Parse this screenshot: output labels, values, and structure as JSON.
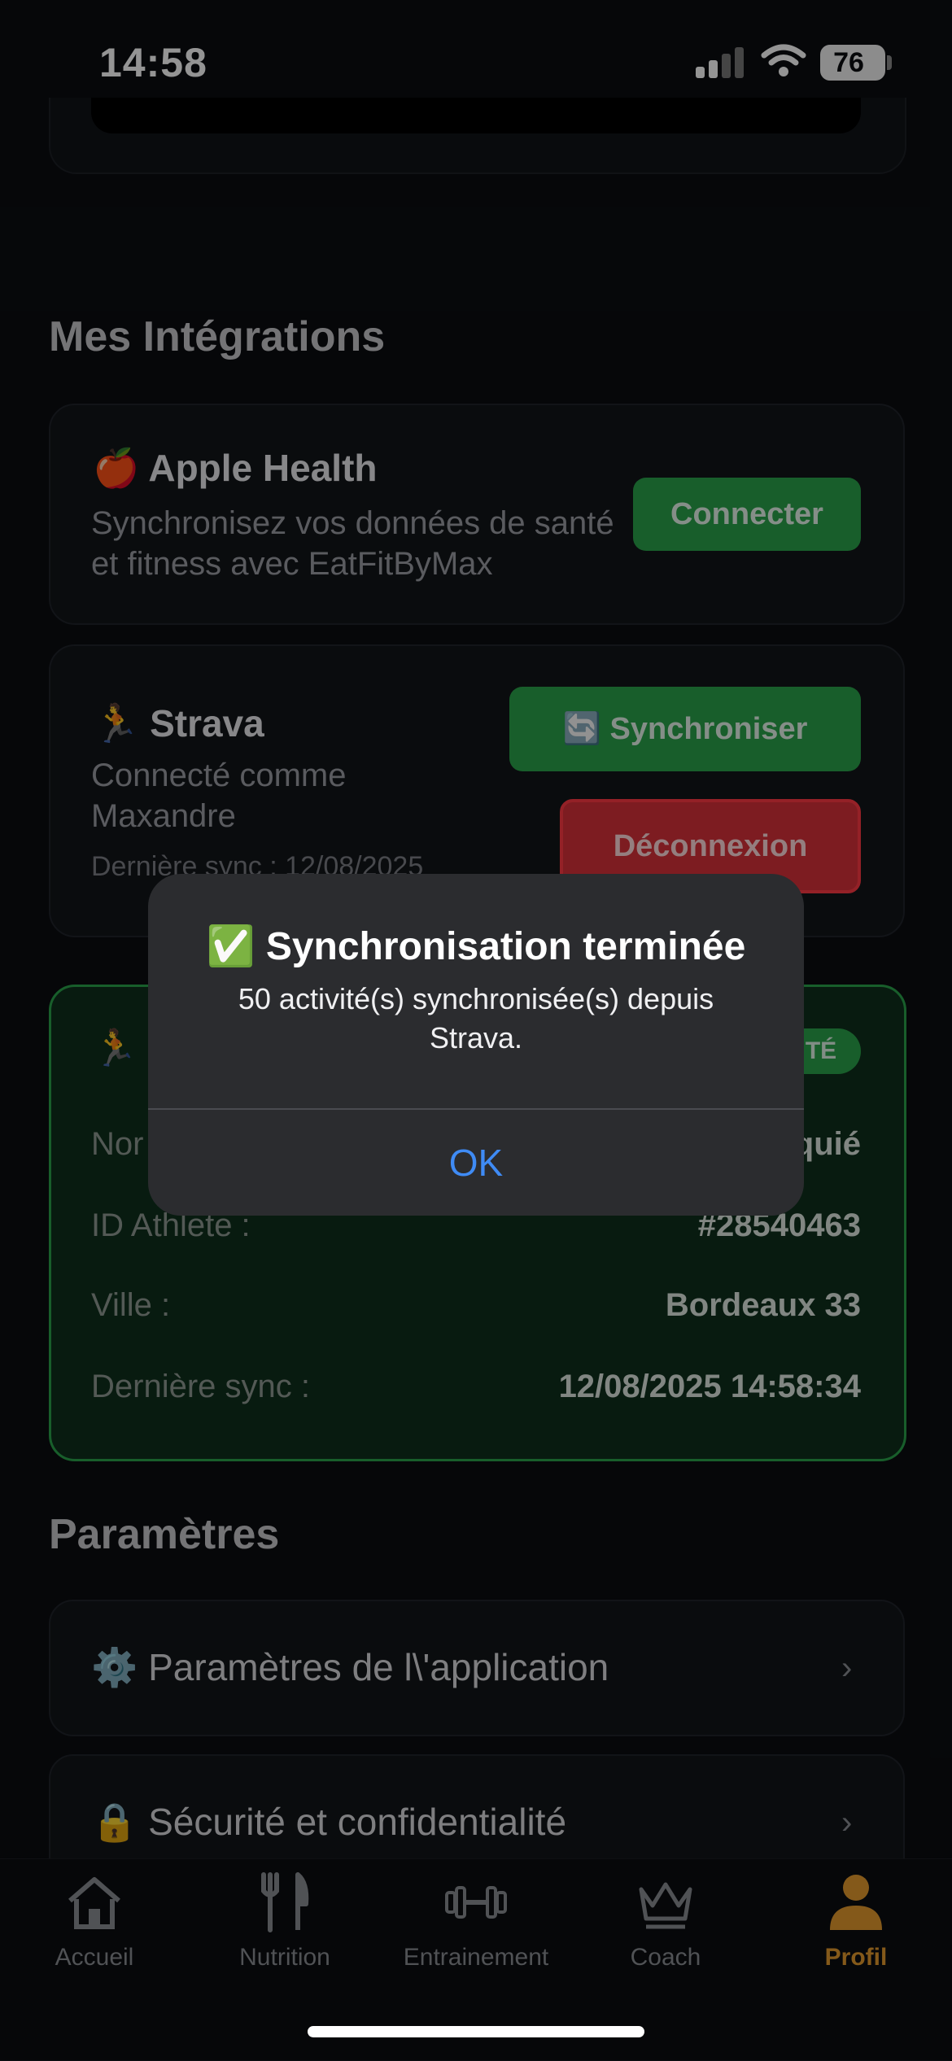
{
  "status_bar": {
    "time": "14:58",
    "battery": "76"
  },
  "integrations": {
    "title": "Mes Intégrations",
    "apple_health": {
      "icon": "🍎",
      "title": "Apple Health",
      "description": "Synchronisez vos données de santé et fitness avec EatFitByMax",
      "connect_label": "Connecter"
    },
    "strava": {
      "icon": "🏃",
      "title": "Strava",
      "connected_as": "Connecté comme Maxandre",
      "last_sync": "Dernière sync : 12/08/2025",
      "sync_button_icon": "🔄",
      "sync_label": "Synchroniser",
      "disconnect_label": "Déconnexion"
    },
    "strava_details": {
      "icon": "🏃",
      "badge": "TÉ",
      "rows": [
        {
          "label": "Nor",
          "value": "quié"
        },
        {
          "label": "ID Athlete :",
          "value": "#28540463"
        },
        {
          "label": "Ville :",
          "value": "Bordeaux 33"
        },
        {
          "label": "Dernière sync :",
          "value": "12/08/2025 14:58:34"
        }
      ]
    }
  },
  "settings": {
    "title": "Paramètres",
    "items": [
      {
        "icon": "⚙️",
        "label": "Paramètres de l\\'application"
      },
      {
        "icon": "🔒",
        "label": "Sécurité et confidentialité"
      }
    ]
  },
  "alert": {
    "icon": "✅",
    "title": "Synchronisation terminée",
    "message": "50 activité(s) synchronisée(s) depuis Strava.",
    "ok_label": "OK"
  },
  "tabbar": {
    "items": [
      {
        "label": "Accueil",
        "icon": "home-icon"
      },
      {
        "label": "Nutrition",
        "icon": "fork-knife-icon"
      },
      {
        "label": "Entrainement",
        "icon": "dumbbell-icon"
      },
      {
        "label": "Coach",
        "icon": "crown-icon"
      },
      {
        "label": "Profil",
        "icon": "person-icon"
      }
    ],
    "active": "Profil"
  },
  "colors": {
    "accent_green": "#2aa34a",
    "danger_red": "#d8313a",
    "active_tab": "#e39a2d",
    "link_blue": "#3f8bf5"
  }
}
